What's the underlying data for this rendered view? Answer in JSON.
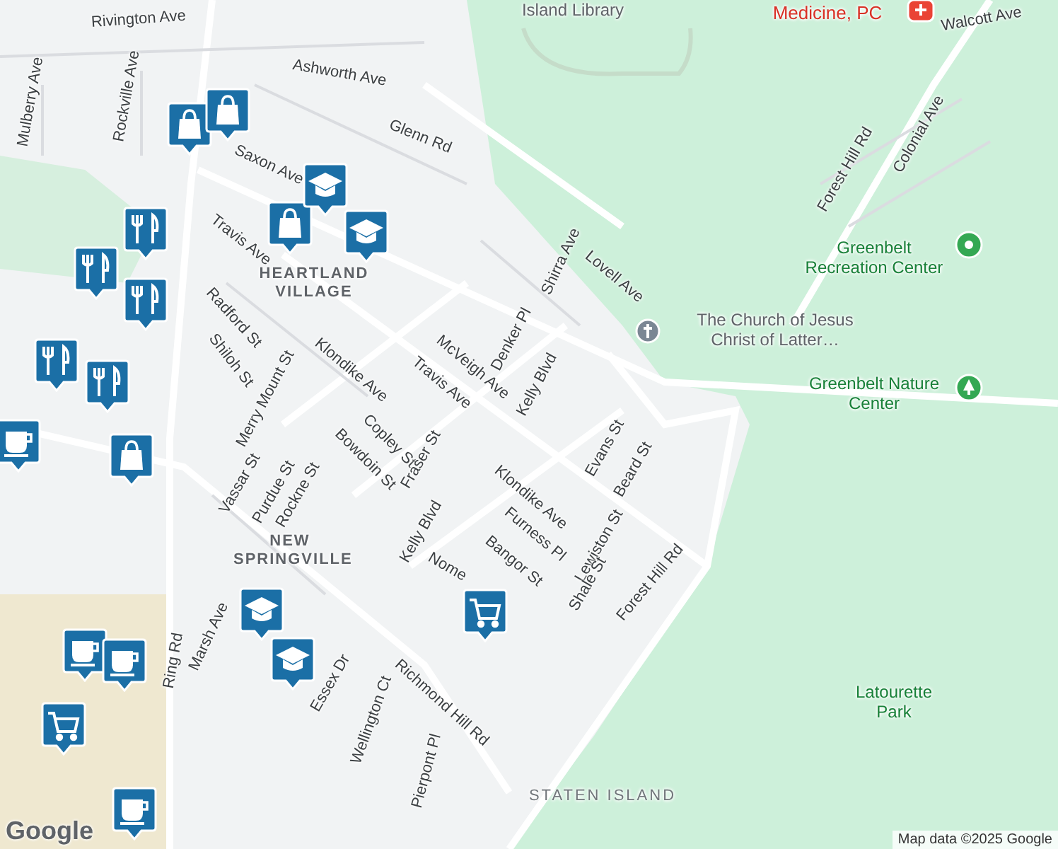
{
  "map": {
    "labels": [
      {
        "text": "Rivington Ave",
        "kind": "street"
      },
      {
        "text": "Ashworth Ave",
        "kind": "street"
      },
      {
        "text": "Glenn Rd",
        "kind": "street"
      },
      {
        "text": "Mulberry Ave",
        "kind": "street"
      },
      {
        "text": "Rockville Ave",
        "kind": "street"
      },
      {
        "text": "Saxon Ave",
        "kind": "street"
      },
      {
        "text": "Travis Ave",
        "kind": "street"
      },
      {
        "text": "Radford St",
        "kind": "street"
      },
      {
        "text": "Shiloh St",
        "kind": "street"
      },
      {
        "text": "HEARTLAND VILLAGE",
        "kind": "district"
      },
      {
        "text": "Klondike Ave",
        "kind": "street"
      },
      {
        "text": "Merry Mount St",
        "kind": "street"
      },
      {
        "text": "McVeigh Ave",
        "kind": "street"
      },
      {
        "text": "Travis Ave",
        "kind": "street"
      },
      {
        "text": "Denker Pl",
        "kind": "street"
      },
      {
        "text": "Kelly Blvd",
        "kind": "street"
      },
      {
        "text": "Shirra Ave",
        "kind": "street"
      },
      {
        "text": "Lovell Ave",
        "kind": "street"
      },
      {
        "text": "The Church of Jesus Christ of Latter…",
        "kind": "place"
      },
      {
        "text": "Greenbelt Recreation Center",
        "kind": "park"
      },
      {
        "text": "Greenbelt Nature Center",
        "kind": "park"
      },
      {
        "text": "Forest Hill Rd",
        "kind": "street"
      },
      {
        "text": "Colonial Ave",
        "kind": "street"
      },
      {
        "text": "Walcott Ave",
        "kind": "street"
      },
      {
        "text": "Island Library",
        "kind": "place"
      },
      {
        "text": "Medicine, PC",
        "kind": "medical"
      },
      {
        "text": "Copley St",
        "kind": "street"
      },
      {
        "text": "Bowdoin St",
        "kind": "street"
      },
      {
        "text": "Fraser St",
        "kind": "street"
      },
      {
        "text": "Vassar St",
        "kind": "street"
      },
      {
        "text": "Purdue St",
        "kind": "street"
      },
      {
        "text": "Rockne St",
        "kind": "street"
      },
      {
        "text": "Klondike Ave",
        "kind": "street"
      },
      {
        "text": "Evans St",
        "kind": "street"
      },
      {
        "text": "Beard St",
        "kind": "street"
      },
      {
        "text": "Kelly Blvd",
        "kind": "street"
      },
      {
        "text": "Furness Pl",
        "kind": "street"
      },
      {
        "text": "Lewiston St",
        "kind": "street"
      },
      {
        "text": "Bangor St",
        "kind": "street"
      },
      {
        "text": "Nome",
        "kind": "street"
      },
      {
        "text": "Shale St",
        "kind": "street"
      },
      {
        "text": "Forest Hill Rd",
        "kind": "street"
      },
      {
        "text": "NEW SPRINGVILLE",
        "kind": "district"
      },
      {
        "text": "Marsh Ave",
        "kind": "street"
      },
      {
        "text": "Ring Rd",
        "kind": "street"
      },
      {
        "text": "Essex Dr",
        "kind": "street"
      },
      {
        "text": "Richmond Hill Rd",
        "kind": "street"
      },
      {
        "text": "Wellington Ct",
        "kind": "street"
      },
      {
        "text": "Pierpont Pl",
        "kind": "street"
      },
      {
        "text": "STATEN ISLAND",
        "kind": "area"
      },
      {
        "text": "Latourette Park",
        "kind": "park"
      }
    ],
    "markers": [
      {
        "kind": "shopping"
      },
      {
        "kind": "shopping"
      },
      {
        "kind": "shopping"
      },
      {
        "kind": "shopping"
      },
      {
        "kind": "school"
      },
      {
        "kind": "school"
      },
      {
        "kind": "school"
      },
      {
        "kind": "school"
      },
      {
        "kind": "restaurant"
      },
      {
        "kind": "restaurant"
      },
      {
        "kind": "restaurant"
      },
      {
        "kind": "restaurant"
      },
      {
        "kind": "restaurant"
      },
      {
        "kind": "coffee"
      },
      {
        "kind": "coffee"
      },
      {
        "kind": "coffee"
      },
      {
        "kind": "coffee"
      },
      {
        "kind": "cart"
      },
      {
        "kind": "cart"
      }
    ],
    "attribution": "Map data ©2025 Google",
    "logo": "Google"
  }
}
